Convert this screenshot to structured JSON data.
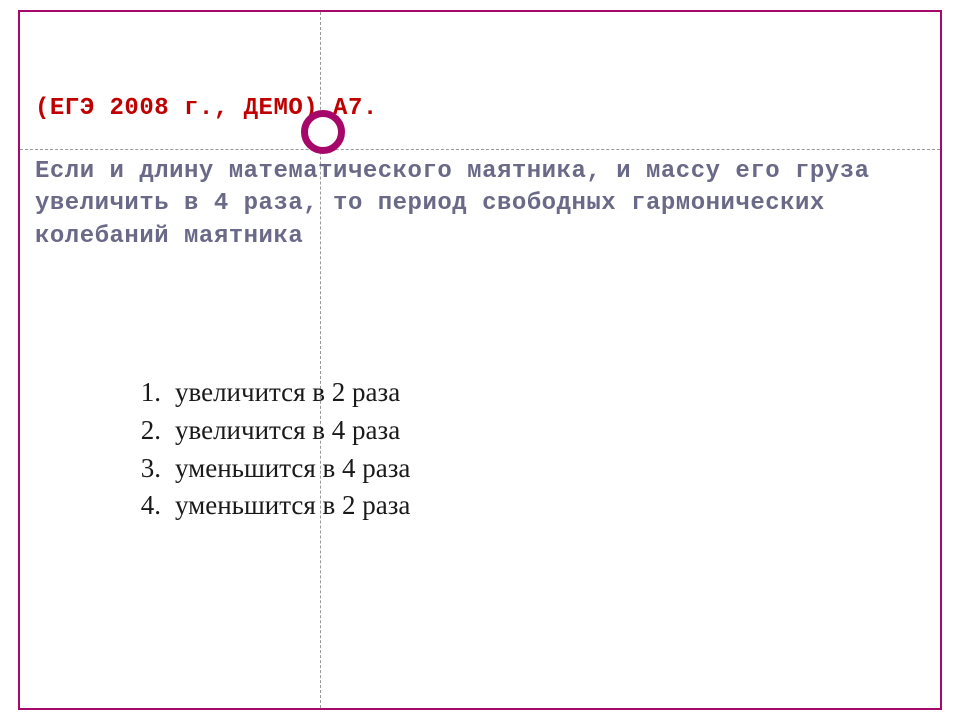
{
  "header": "(ЕГЭ 2008 г., ДЕМО) А7.",
  "body": "Если и длину математического маятника, и массу его груза увеличить в 4 раза, то период свободных гармонических колебаний маятника",
  "answers": [
    {
      "num": "1.",
      "text": "увеличится в 2 раза"
    },
    {
      "num": "2.",
      "text": "увеличится в 4 раза"
    },
    {
      "num": "3.",
      "text": "уменьшится в 4 раза"
    },
    {
      "num": "4.",
      "text": "уменьшится в 2 раза"
    }
  ]
}
